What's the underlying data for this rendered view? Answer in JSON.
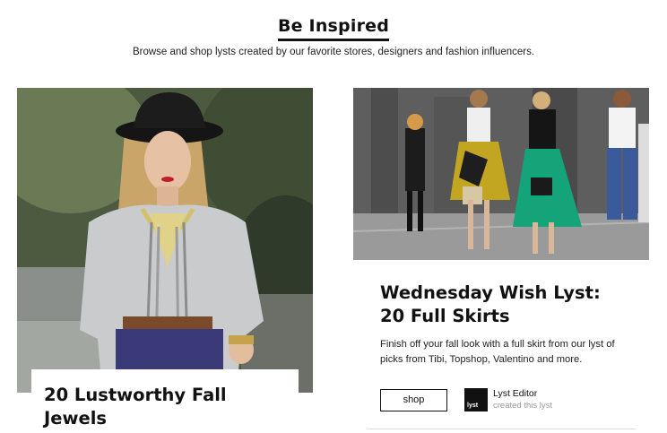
{
  "section": {
    "title": "Be Inspired",
    "subtitle": "Browse and shop lysts created by our favorite stores, designers and fashion influencers."
  },
  "cards": [
    {
      "title": "20 Lustworthy Fall Jewels",
      "image": "woman-in-black-hat-with-layered-necklaces"
    },
    {
      "title": "Wednesday Wish Lyst: 20 Full Skirts",
      "description": "Finish off your fall look with a full skirt from our lyst of picks from Tibi, Topshop, Valentino and more.",
      "image": "street-style-full-skirts",
      "shop_label": "shop",
      "author": {
        "avatar_text": "lyst",
        "name": "Lyst Editor",
        "subtitle": "created this lyst"
      }
    }
  ]
}
